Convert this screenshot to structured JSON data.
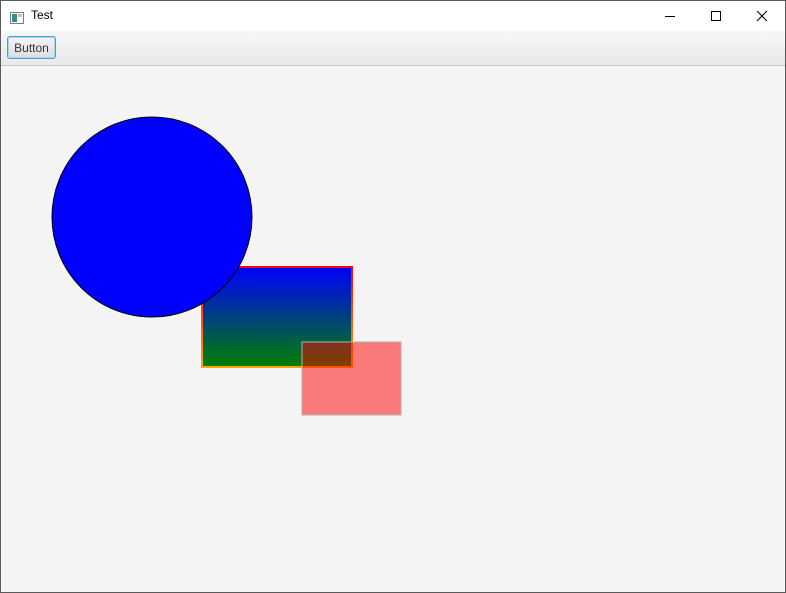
{
  "window": {
    "title": "Test"
  },
  "toolbar": {
    "button_label": "Button"
  },
  "colors": {
    "circle_fill": "#0000ff",
    "circle_stroke": "#000000",
    "rect_gradient_top": "#0000ff",
    "rect_gradient_bottom": "#008000",
    "rect_stroke_top": "#ff0000",
    "rect_stroke_bottom": "#ffa500",
    "overlay_rect_fill": "#ff0000",
    "overlay_rect_opacity": "0.5",
    "background": "#f4f4f4",
    "button_border": "#3ba3d9"
  },
  "icons": {
    "app": "app-window-icon",
    "minimize": "minimize-icon",
    "maximize": "maximize-icon",
    "close": "close-icon"
  }
}
